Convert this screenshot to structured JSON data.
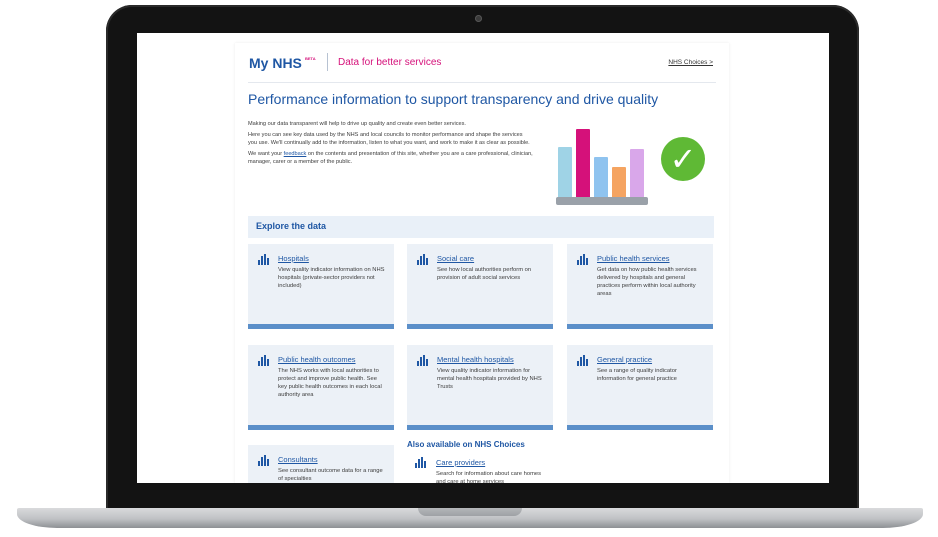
{
  "header": {
    "logo": "My NHS",
    "beta": "BETA",
    "tagline": "Data for better services",
    "nhs_choices_link": "NHS Choices >"
  },
  "headline": "Performance information to support transparency and drive quality",
  "intro": {
    "p1": "Making our data transparent will help to drive up quality and create even better services.",
    "p2": "Here you can see key data used by the NHS and local councils to monitor performance and shape the services you use. We'll continually add to the information, listen to what you want, and work to make it as clear as possible.",
    "p3_before": "We want your ",
    "p3_link": "feedback",
    "p3_after": " on the contents and presentation of this site, whether you are a care professional, clinician, manager, carer or a member of the public."
  },
  "hero": {
    "bar_colors": [
      "#9fd3e6",
      "#d5117a",
      "#8fc3ef",
      "#f5a461",
      "#d9a7ea"
    ],
    "tick_color": "#5fb935",
    "icon": "checkmark-icon"
  },
  "explore": {
    "heading": "Explore the data"
  },
  "cards": [
    {
      "title": "Hospitals",
      "desc": "View quality indicator information on NHS hospitals (private-sector providers not included)"
    },
    {
      "title": "Social care",
      "desc": "See how local authorities perform on provision of adult social services"
    },
    {
      "title": "Public health services",
      "desc": "Get data on how public health services delivered by hospitals and general practices perform within local authority areas"
    },
    {
      "title": "Public health outcomes",
      "desc": "The NHS works with local authorities to protect and improve public health. See key public health outcomes in each local authority area"
    },
    {
      "title": "Mental health hospitals",
      "desc": "View quality indicator information for mental health hospitals provided by NHS Trusts"
    },
    {
      "title": "General practice",
      "desc": "See a range of quality indicator information for general practice"
    },
    {
      "title": "Consultants",
      "desc": "See consultant outcome data for a range of specialties"
    }
  ],
  "also": {
    "heading": "Also available on NHS Choices",
    "care_title": "Care providers",
    "care_desc": "Search for information about care homes and care at home services"
  },
  "colors": {
    "nhs_blue": "#1f57a4",
    "accent_pink": "#d5117a",
    "card_bg": "#ecf1f7",
    "card_border": "#5b8fc9"
  }
}
